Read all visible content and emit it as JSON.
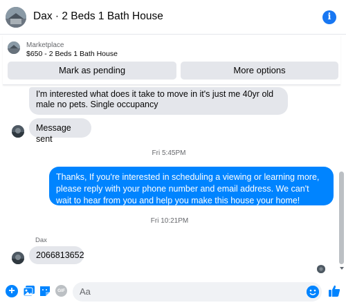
{
  "header": {
    "title": "Dax · 2 Beds 1 Bath House",
    "info_icon": "i"
  },
  "marketplace": {
    "label": "Marketplace",
    "listing": "$650 - 2 Beds 1 Bath House",
    "buttons": {
      "pending": "Mark as pending",
      "more": "More options"
    }
  },
  "messages": [
    {
      "direction": "incoming",
      "text": "I'm interested what does it take to move in it's just me 40yr old male no pets. Single occupancy"
    },
    {
      "direction": "incoming",
      "text": "Message sent"
    },
    {
      "direction": "outgoing",
      "text": "Thanks, If you're interested in scheduling a viewing or learning more, please reply with your phone number and email address. We can't wait to hear from you and help you make this house your home!"
    },
    {
      "direction": "incoming",
      "text": "2066813652",
      "sender": "Dax"
    }
  ],
  "timestamps": [
    "Fri 5:45PM",
    "Fri 10:21PM"
  ],
  "composer": {
    "placeholder": "Aa",
    "gif_label": "GIF"
  },
  "colors": {
    "accent": "#0084ff",
    "incoming_bubble": "#e4e6eb",
    "button_bg": "#e4e6eb"
  }
}
